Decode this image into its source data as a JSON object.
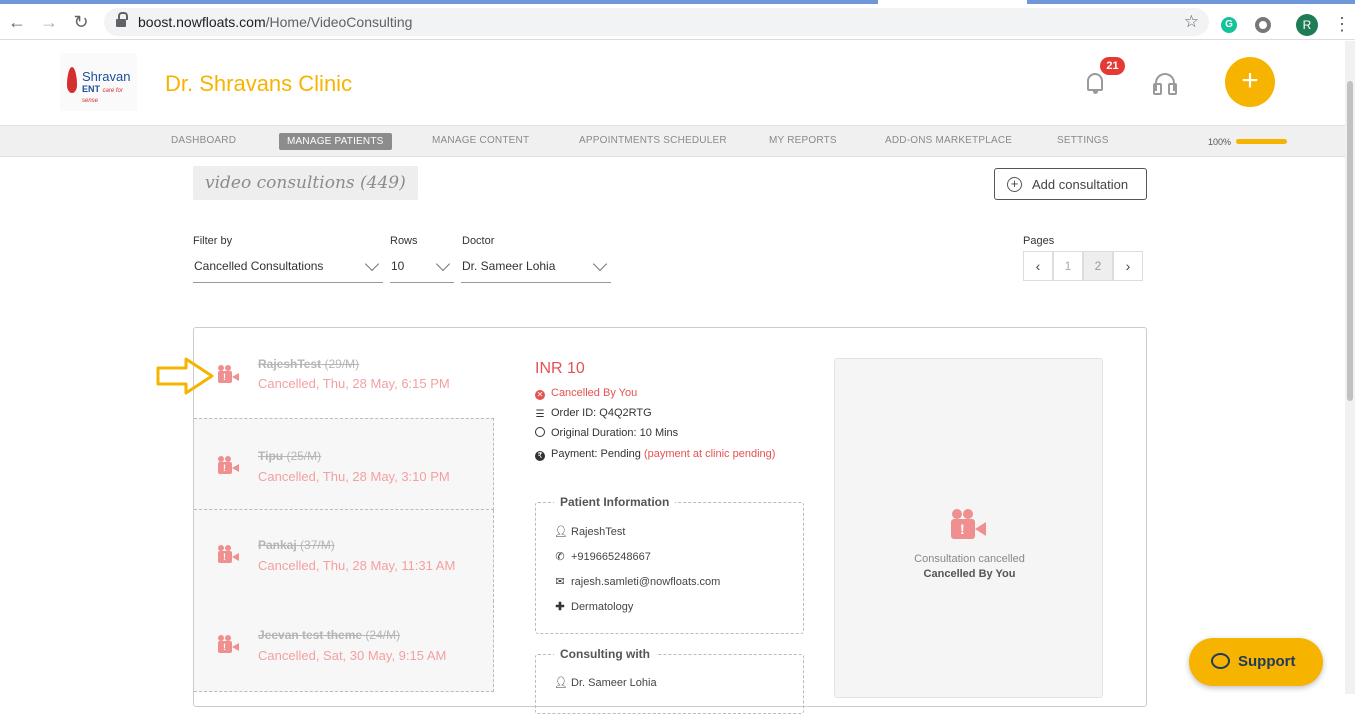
{
  "browser": {
    "url_host": "boost.nowfloats.com",
    "url_path": "/Home/VideoConsulting",
    "profile_initial": "R",
    "grammarly_letter": "G"
  },
  "header": {
    "logo_name": "Shravan",
    "logo_sub": "ENT",
    "logo_tagline": "care for sense",
    "clinic_name": "Dr. Shravans Clinic",
    "notification_count": "21",
    "fab_symbol": "+"
  },
  "nav": {
    "items": [
      {
        "label": "DASHBOARD",
        "active": false
      },
      {
        "label": "MANAGE PATIENTS",
        "active": true
      },
      {
        "label": "MANAGE CONTENT",
        "active": false
      },
      {
        "label": "APPOINTMENTS SCHEDULER",
        "active": false
      },
      {
        "label": "MY REPORTS",
        "active": false
      },
      {
        "label": "ADD-ONS MARKETPLACE",
        "active": false
      },
      {
        "label": "SETTINGS",
        "active": false
      }
    ],
    "progress_label": "100%",
    "progress_value": 1.0
  },
  "page": {
    "title": "video consultions (449)",
    "add_button": "Add consultation"
  },
  "filters": {
    "filter_label": "Filter by",
    "filter_value": "Cancelled Consultations",
    "rows_label": "Rows",
    "rows_value": "10",
    "doctor_label": "Doctor",
    "doctor_value": "Dr. Sameer Lohia",
    "pages_label": "Pages",
    "prev": "‹",
    "next": "›",
    "pages": [
      "1",
      "2"
    ],
    "current_page": "2"
  },
  "consultations": [
    {
      "name": "RajeshTest",
      "age": "(29/M)",
      "status": "Cancelled, Thu, 28 May, 6:15 PM"
    },
    {
      "name": "Tipu",
      "age": "(25/M)",
      "status": "Cancelled, Thu, 28 May, 3:10 PM"
    },
    {
      "name": "Pankaj",
      "age": "(37/M)",
      "status": "Cancelled, Thu, 28 May, 11:31 AM"
    },
    {
      "name": "Jeevan test theme",
      "age": "(24/M)",
      "status": "Cancelled, Sat, 30 May, 9:15 AM"
    }
  ],
  "detail": {
    "price": "INR 10",
    "cancelled_by": "Cancelled By You",
    "order_id": "Order ID: Q4Q2RTG",
    "duration": "Original Duration: 10 Mins",
    "payment": "Payment: Pending",
    "payment_note": "(payment at clinic pending)",
    "patient_info_title": "Patient Information",
    "patient_name": "RajeshTest",
    "patient_phone": "+919665248667",
    "patient_email": "rajesh.samleti@nowfloats.com",
    "patient_specialty": "Dermatology",
    "consulting_title": "Consulting with",
    "consulting_doctor": "Dr. Sameer Lohia"
  },
  "panel": {
    "line1": "Consultation cancelled",
    "line2": "Cancelled By You"
  },
  "support": {
    "label": "Support"
  },
  "colors": {
    "brand_yellow": "#f6b400",
    "cancel_red": "#e55252",
    "cancel_pink": "#f4a0a0"
  }
}
